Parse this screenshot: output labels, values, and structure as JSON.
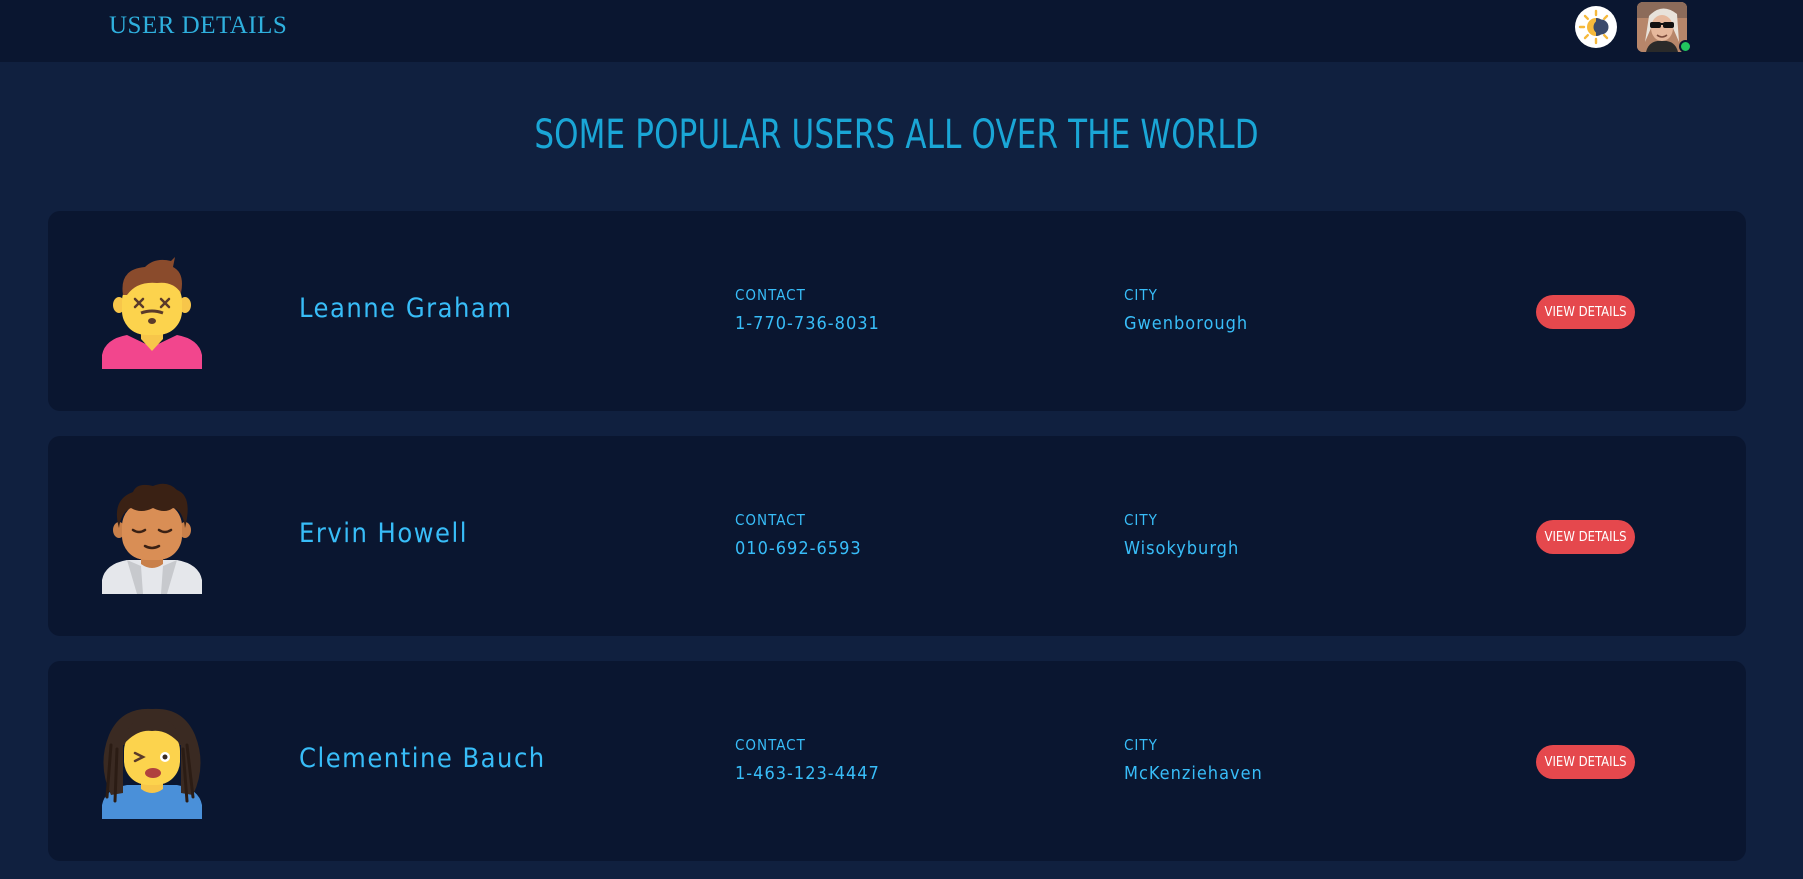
{
  "header": {
    "title": "USER DETAILS",
    "theme_icon": "sun-moon-icon",
    "avatar_icon": "user-avatar-icon"
  },
  "main": {
    "heading": "SOME POPULAR USERS ALL OVER THE WORLD"
  },
  "colors": {
    "page_background": "#10203f",
    "card_background": "#0a1630",
    "accent": "#38bdf8",
    "button": "#e5484d",
    "online_status": "#22c55e"
  },
  "users": [
    {
      "name": "Leanne Graham",
      "contact_label": "CONTACT",
      "contact": "1-770-736-8031",
      "city_label": "CITY",
      "city": "Gwenborough",
      "button_label": "VIEW DETAILS",
      "avatar_icon": "avatar-man-dizzy-icon"
    },
    {
      "name": "Ervin Howell",
      "contact_label": "CONTACT",
      "contact": "010-692-6593",
      "city_label": "CITY",
      "city": "Wisokyburgh",
      "button_label": "VIEW DETAILS",
      "avatar_icon": "avatar-person-sleepy-icon"
    },
    {
      "name": "Clementine Bauch",
      "contact_label": "CONTACT",
      "contact": "1-463-123-4447",
      "city_label": "CITY",
      "city": "McKenziehaven",
      "button_label": "VIEW DETAILS",
      "avatar_icon": "avatar-woman-dreadlocks-icon"
    }
  ]
}
